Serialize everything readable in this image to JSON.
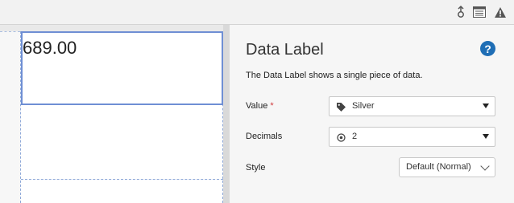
{
  "toolbar": {
    "icons": [
      "upload-icon",
      "list-icon",
      "warning-icon"
    ]
  },
  "canvas": {
    "widget_value": "689.00"
  },
  "panel": {
    "title": "Data Label",
    "help_label": "?",
    "description": "The Data Label shows a single piece of data.",
    "value": {
      "label": "Value",
      "required_mark": "*",
      "selected": "Silver",
      "icon": "tag-icon"
    },
    "decimals": {
      "label": "Decimals",
      "selected": "2",
      "icon": "target-icon"
    },
    "style": {
      "label": "Style",
      "selected": "Default (Normal)"
    }
  },
  "colors": {
    "accent": "#1f6eb5",
    "selection": "#6f8fd4",
    "required": "#d0393b"
  }
}
